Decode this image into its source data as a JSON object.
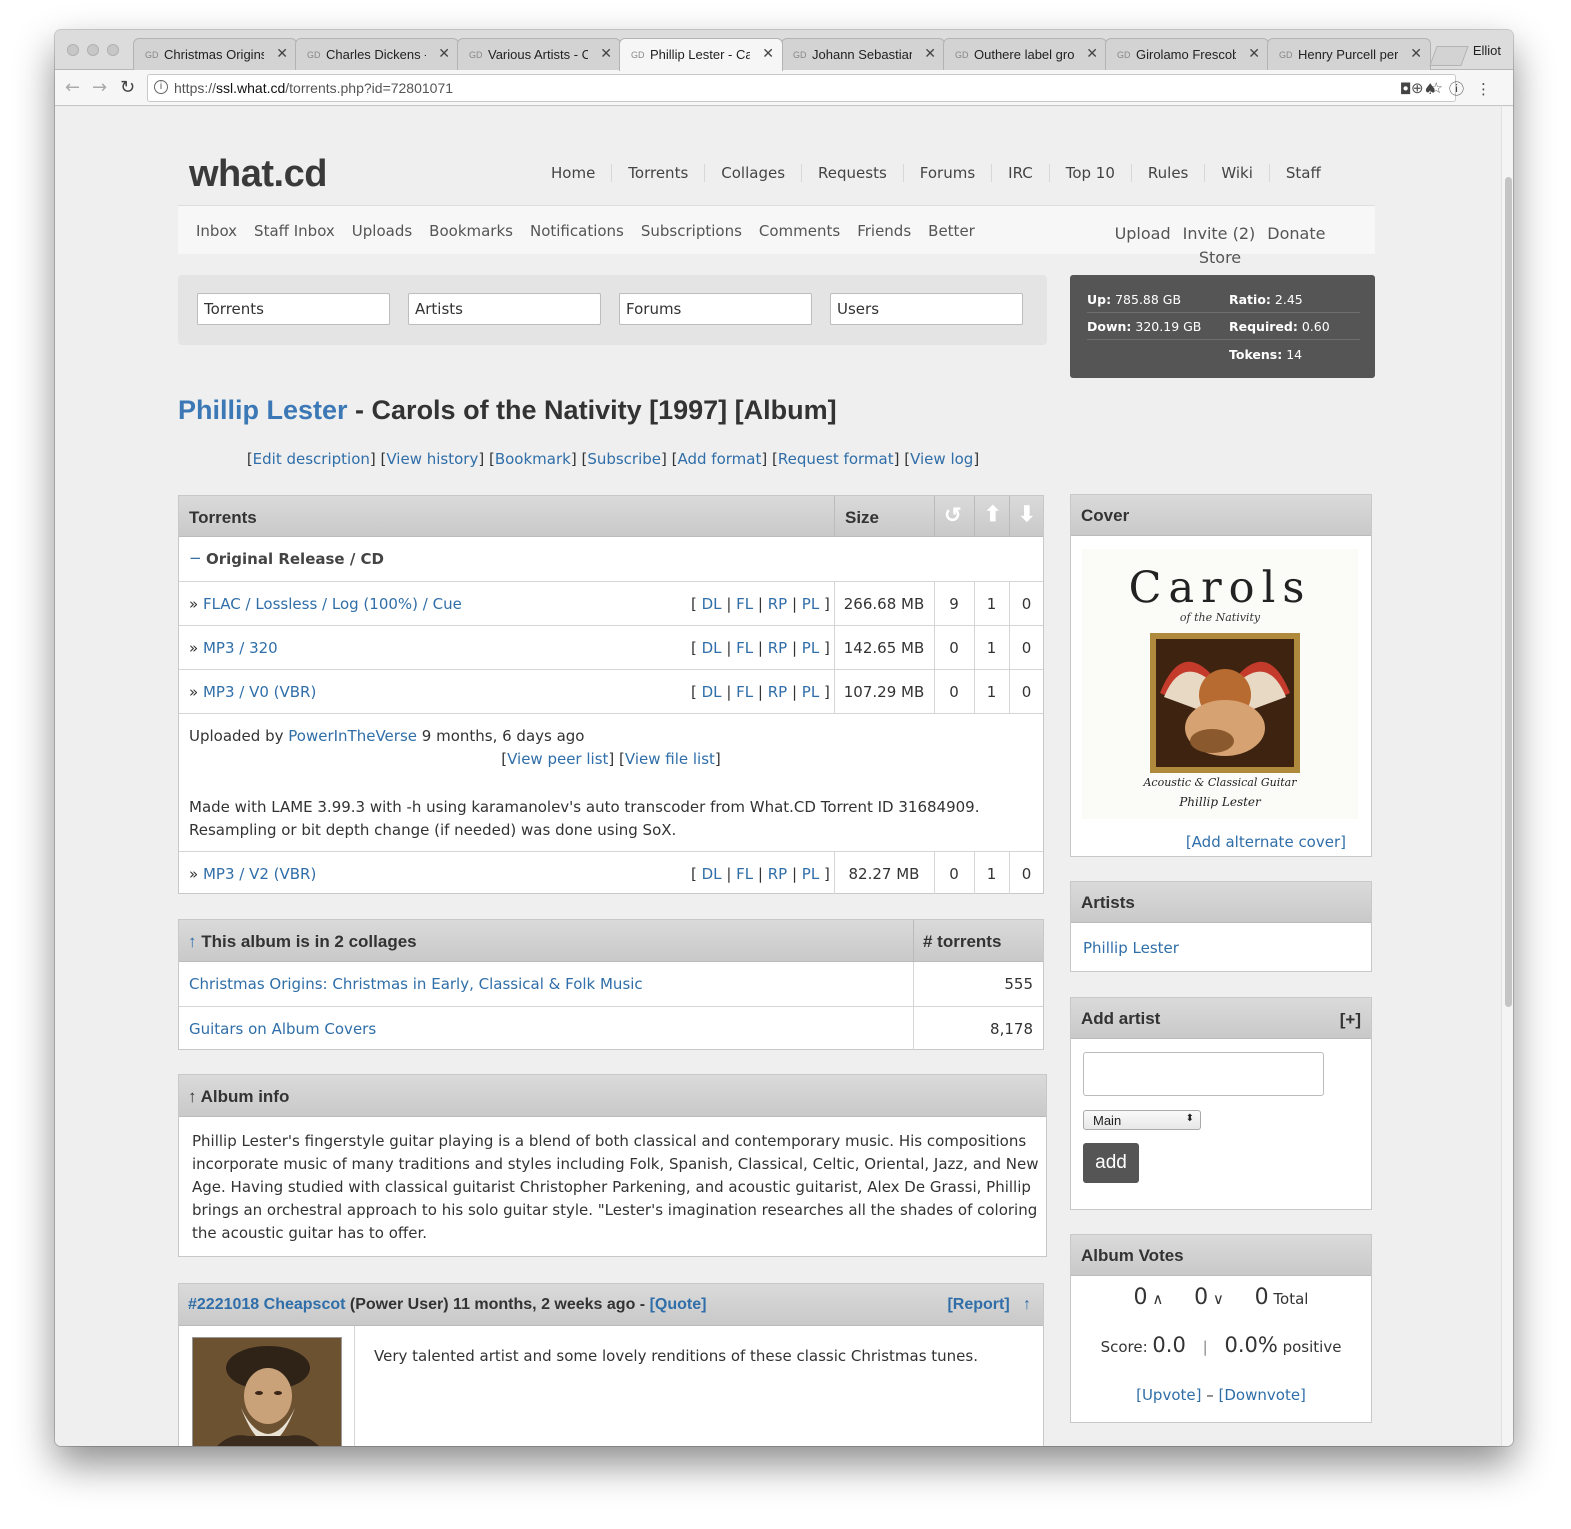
{
  "browser": {
    "tabs": [
      {
        "title": "Christmas Origins:"
      },
      {
        "title": "Charles Dickens - A"
      },
      {
        "title": "Various Artists - Ch"
      },
      {
        "title": "Phillip Lester - Car"
      },
      {
        "title": "Johann Sebastian B"
      },
      {
        "title": "Outhere label grou"
      },
      {
        "title": "Girolamo Frescoba"
      },
      {
        "title": "Henry Purcell perfo"
      }
    ],
    "profile": "Elliot",
    "url_scheme": "https://",
    "url_host": "ssl.what.cd",
    "url_path": "/torrents.php?id=72801071"
  },
  "site": {
    "logo": "what.cd",
    "main_nav": [
      "Home",
      "Torrents",
      "Collages",
      "Requests",
      "Forums",
      "IRC",
      "Top 10",
      "Rules",
      "Wiki",
      "Staff"
    ],
    "user_nav": [
      "Inbox",
      "Staff Inbox",
      "Uploads",
      "Bookmarks",
      "Notifications",
      "Subscriptions",
      "Comments",
      "Friends",
      "Better"
    ],
    "upload": "Upload",
    "invite": "Invite (2)",
    "donate": "Donate",
    "store": "Store"
  },
  "search": {
    "torrents": "Torrents",
    "artists": "Artists",
    "forums": "Forums",
    "users": "Users"
  },
  "stats": {
    "up_label": "Up:",
    "up": "785.88 GB",
    "down_label": "Down:",
    "down": "320.19 GB",
    "ratio_label": "Ratio:",
    "ratio": "2.45",
    "required_label": "Required:",
    "required": "0.60",
    "tokens_label": "Tokens:",
    "tokens": "14"
  },
  "album": {
    "artist": "Phillip Lester",
    "title_rest": " - Carols of the Nativity [1997] [Album]",
    "actions": [
      "Edit description",
      "View history",
      "Bookmark",
      "Subscribe",
      "Add format",
      "Request format",
      "View log"
    ]
  },
  "torrents": {
    "header": "Torrents",
    "size_header": "Size",
    "group": "Original Release / CD",
    "group_toggle": "−",
    "action_links": [
      "DL",
      "FL",
      "RP",
      "PL"
    ],
    "rows": [
      {
        "format": "FLAC / Lossless / Log (100%) / Cue",
        "size": "266.68 MB",
        "snatched": "9",
        "seeders": "1",
        "leechers": "0"
      },
      {
        "format": "MP3 / 320",
        "size": "142.65 MB",
        "snatched": "0",
        "seeders": "1",
        "leechers": "0"
      },
      {
        "format": "MP3 / V0 (VBR)",
        "size": "107.29 MB",
        "snatched": "0",
        "seeders": "1",
        "leechers": "0"
      },
      {
        "format": "MP3 / V2 (VBR)",
        "size": "82.27 MB",
        "snatched": "0",
        "seeders": "1",
        "leechers": "0"
      }
    ],
    "uploaded_by_label": "Uploaded by",
    "uploader": "PowerInTheVerse",
    "uploaded_ago": "9 months, 6 days ago",
    "view_peer_list": "View peer list",
    "view_file_list": "View file list",
    "description_line1": "Made with LAME 3.99.3 with -h using karamanolev's auto transcoder from What.CD Torrent ID 31684909.",
    "description_line2": "Resampling or bit depth change (if needed) was done using SoX."
  },
  "collages": {
    "header": "This album is in 2 collages",
    "count_header": "# torrents",
    "rows": [
      {
        "name": "Christmas Origins: Christmas in Early, Classical & Folk Music",
        "count": "555"
      },
      {
        "name": "Guitars on Album Covers",
        "count": "8,178"
      }
    ]
  },
  "album_info": {
    "header": "Album info",
    "lines": [
      "Phillip Lester's fingerstyle guitar playing is a blend of both classical and contemporary music. His compositions",
      "incorporate music of many traditions and styles including Folk, Spanish, Classical, Celtic, Oriental, Jazz, and New",
      "Age. Having studied with classical guitarist Christopher Parkening, and acoustic guitarist, Alex De Grassi, Phillip",
      "brings an orchestral approach to his solo guitar style. \"Lester's imagination researches all the shades of coloring",
      "the acoustic guitar has to offer."
    ]
  },
  "comment": {
    "id": "#2221018",
    "author": "Cheapscot",
    "role": "(Power User)",
    "time": "11 months, 2 weeks ago -",
    "quote": "[Quote]",
    "report": "[Report]",
    "up_arrow": "↑",
    "body": "Very talented artist and some lovely renditions of these classic Christmas tunes."
  },
  "sidebar": {
    "cover_header": "Cover",
    "cover_title": "Carols",
    "cover_subtitle": "of the Nativity",
    "cover_line1": "Acoustic & Classical Guitar",
    "cover_line2": "Phillip Lester",
    "add_alternate_cover": "[Add alternate cover]",
    "artists_header": "Artists",
    "artist_name": "Phillip Lester",
    "add_artist_header": "Add artist",
    "add_artist_plus": "[+]",
    "role_selected": "Main",
    "add_button": "add",
    "votes_header": "Album Votes",
    "up_votes": "0",
    "down_votes": "0",
    "total_votes": "0",
    "total_label": "Total",
    "score_label": "Score:",
    "score": "0.0",
    "positive_pct": "0.0%",
    "positive_label": "positive",
    "upvote": "[Upvote]",
    "dash": "–",
    "downvote": "[Downvote]"
  }
}
